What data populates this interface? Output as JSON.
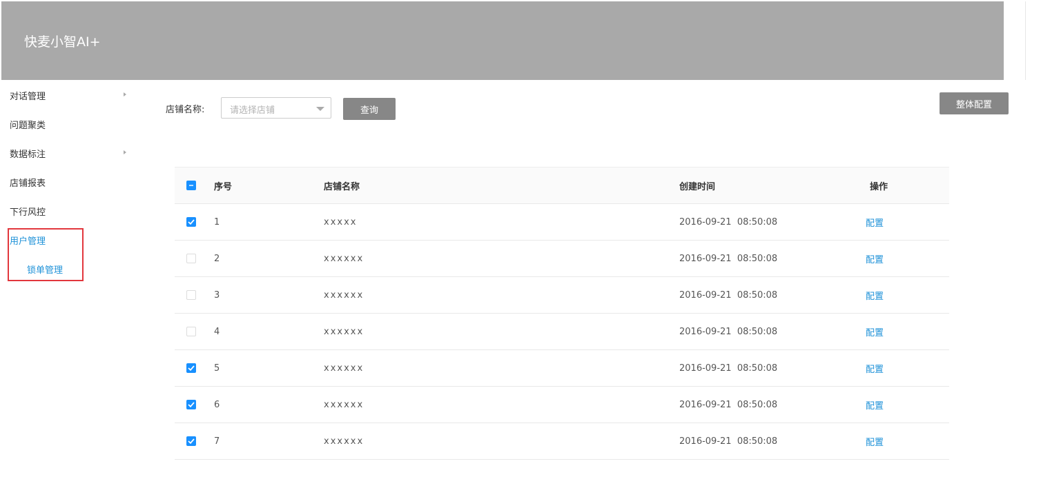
{
  "header": {
    "title": "快麦小智AI+"
  },
  "sidebar": {
    "items": [
      {
        "label": "对话管理",
        "has_submenu": true
      },
      {
        "label": "问题聚类",
        "has_submenu": false
      },
      {
        "label": "数据标注",
        "has_submenu": true
      },
      {
        "label": "店铺报表",
        "has_submenu": false
      },
      {
        "label": "下行风控",
        "has_submenu": false
      },
      {
        "label": "用户管理",
        "active": true
      },
      {
        "label": "锁单管理",
        "active": true,
        "sub": true
      }
    ]
  },
  "filter": {
    "label": "店铺名称:",
    "select_placeholder": "请选择店铺",
    "query_button": "查询"
  },
  "toolbar": {
    "config_all_button": "整体配置"
  },
  "table": {
    "header_checkbox": "indeterminate",
    "columns": [
      "序号",
      "店铺名称",
      "创建时间",
      "操作"
    ],
    "rows": [
      {
        "checked": true,
        "index": "1",
        "name": "xxxxx",
        "created": "2016-09-21  08:50:08",
        "action": "配置"
      },
      {
        "checked": false,
        "index": "2",
        "name": "xxxxxx",
        "created": "2016-09-21  08:50:08",
        "action": "配置"
      },
      {
        "checked": false,
        "index": "3",
        "name": "xxxxxx",
        "created": "2016-09-21  08:50:08",
        "action": "配置"
      },
      {
        "checked": false,
        "index": "4",
        "name": "xxxxxx",
        "created": "2016-09-21  08:50:08",
        "action": "配置"
      },
      {
        "checked": true,
        "index": "5",
        "name": "xxxxxx",
        "created": "2016-09-21  08:50:08",
        "action": "配置"
      },
      {
        "checked": true,
        "index": "6",
        "name": "xxxxxx",
        "created": "2016-09-21  08:50:08",
        "action": "配置"
      },
      {
        "checked": true,
        "index": "7",
        "name": "xxxxxx",
        "created": "2016-09-21  08:50:08",
        "action": "配置"
      }
    ]
  },
  "colors": {
    "accent": "#1890ff",
    "link": "#1f92d8",
    "header_bg": "#a9a9a9",
    "button_bg": "#878787",
    "highlight": "#e2363c"
  }
}
